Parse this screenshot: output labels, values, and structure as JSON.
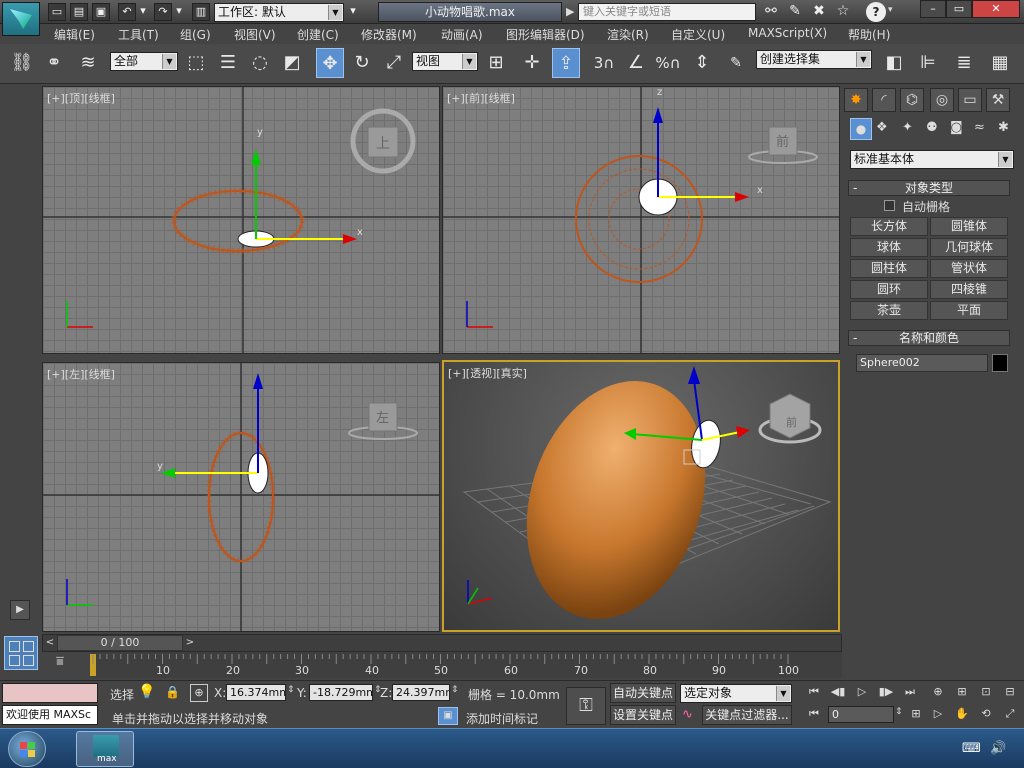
{
  "titlebar": {
    "workspace_label": "工作区: 默认",
    "file_title": "小动物唱歌.max",
    "search_placeholder": "键入关键字或短语",
    "help_label": "?"
  },
  "menu": [
    "编辑(E)",
    "工具(T)",
    "组(G)",
    "视图(V)",
    "创建(C)",
    "修改器(M)",
    "动画(A)",
    "图形编辑器(D)",
    "渲染(R)",
    "自定义(U)",
    "MAXScript(X)",
    "帮助(H)"
  ],
  "toolbar": {
    "filter_value": "全部",
    "refcoord_value": "视图",
    "angle_snap_label": "3",
    "percent_snap_label": "%",
    "selection_set_value": "创建选择集"
  },
  "viewports": {
    "top": {
      "label": "[+][顶][线框]",
      "cube": "上"
    },
    "front": {
      "label": "[+][前][线框]",
      "cube": "前"
    },
    "left": {
      "label": "[+][左][线框]",
      "cube": "左"
    },
    "persp": {
      "label": "[+][透视][真实]",
      "cube": "前"
    },
    "axis_x": "x",
    "axis_y": "y",
    "axis_z": "z"
  },
  "command_panel": {
    "category_value": "标准基本体",
    "object_type_title": "对象类型",
    "autogrid_label": "自动栅格",
    "buttons": [
      "长方体",
      "圆锥体",
      "球体",
      "几何球体",
      "圆柱体",
      "管状体",
      "圆环",
      "四棱锥",
      "茶壶",
      "平面"
    ],
    "name_color_title": "名称和颜色",
    "object_name": "Sphere002",
    "object_color": "#000000"
  },
  "timeline": {
    "frame_label": "0 / 100",
    "ticks": [
      "10",
      "20",
      "30",
      "40",
      "50",
      "60",
      "70",
      "80",
      "90",
      "100"
    ]
  },
  "statusbar": {
    "welcome_text": "欢迎使用 MAXSc",
    "select_label": "选择",
    "x_label": "X:",
    "x_value": "16.374mm",
    "y_label": "Y:",
    "y_value": "-18.729mm",
    "z_label": "Z:",
    "z_value": "24.397mm",
    "grid_label": "栅格 = 10.0mm",
    "prompt_text": "单击并拖动以选择并移动对象",
    "add_time_tag": "添加时间标记",
    "auto_key": "自动关键点",
    "set_key": "设置关键点",
    "key_mode_value": "选定对象",
    "key_filters": "关键点过滤器...",
    "current_frame": "0"
  },
  "taskbar": {
    "app_label": "max"
  }
}
